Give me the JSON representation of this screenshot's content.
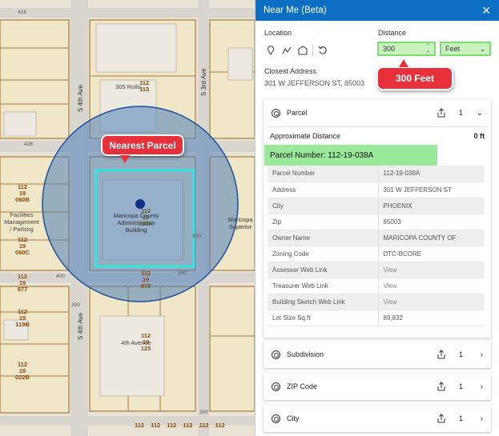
{
  "map": {
    "parcel_numbers": [
      {
        "top": "112",
        "mid": "",
        "bot": "113",
        "name": "305 Rollo"
      },
      {
        "top": "112",
        "mid": "19",
        "bot": "060B",
        "name": "left-upper"
      },
      {
        "top": "112",
        "mid": "19",
        "bot": "060C",
        "name": "left-mid"
      },
      {
        "top": "112",
        "mid": "19",
        "bot": "977",
        "name": "left-977"
      },
      {
        "top": "112",
        "mid": "19",
        "bot": "119B",
        "name": "left-119B"
      },
      {
        "top": "112",
        "mid": "19",
        "bot": "022B",
        "name": "left-022B"
      },
      {
        "top": "112",
        "mid": "19",
        "bot": "978",
        "name": "center-978"
      },
      {
        "top": "112",
        "mid": "19",
        "bot": "125",
        "name": "center-125"
      }
    ],
    "labels": {
      "rollo_bldg": "305 Rollo",
      "facilities_1": "Facilities",
      "facilities_2": "Management",
      "facilities_3": "/ Parking",
      "maricopa_1": "Maricopa County",
      "maricopa_2": "Administration",
      "maricopa_3": "Building",
      "superior_1": "Maricopa",
      "superior_2": "Superior",
      "fourth_ave_bldg": "4th Avenue",
      "center_parcel": "112\n19\n038A"
    },
    "street_labels": {
      "s4th_top": "S 4th Ave",
      "s3rd": "S 3rd Ave",
      "s4th_bottom": "S 4th Ave"
    },
    "address_numbers": {
      "n416": "416",
      "n428": "428",
      "n400": "400",
      "n300a": "300",
      "n300b": "300",
      "n300c": "300",
      "n300d": "300"
    },
    "callouts": {
      "nearest_parcel": "Nearest Parcel",
      "distance_300": "300 Feet"
    },
    "bottom_numbers": [
      "112",
      "112",
      "112",
      "112",
      "112",
      "112"
    ]
  },
  "panel": {
    "title": "Near Me (Beta)",
    "location_label": "Location",
    "distance_label": "Distance",
    "distance_value": "300",
    "unit_value": "Feet",
    "closest_address_label": "Closest Address",
    "closest_address_value": "301 W JEFFERSON ST, 85003",
    "cards": [
      {
        "title": "Parcel",
        "count": "1",
        "expanded": true
      },
      {
        "title": "Subdivision",
        "count": "1",
        "expanded": false
      },
      {
        "title": "ZIP Code",
        "count": "1",
        "expanded": false
      },
      {
        "title": "City",
        "count": "1",
        "expanded": false
      }
    ],
    "approx_distance_label": "Approximate Distance",
    "approx_distance_value": "0 ft",
    "parcel_number_label": "Parcel Number: 112-19-038A",
    "attributes": [
      {
        "k": "Parcel Number",
        "v": "112-19-038A"
      },
      {
        "k": "Address",
        "v": "301 W JEFFERSON ST"
      },
      {
        "k": "City",
        "v": "PHOENIX"
      },
      {
        "k": "Zip",
        "v": "85003"
      },
      {
        "k": "Owner Name",
        "v": "MARICOPA COUNTY OF"
      },
      {
        "k": "Zoning Code",
        "v": "DTC-BCORE"
      },
      {
        "k": "Assessor Web Link",
        "v": "View"
      },
      {
        "k": "Treasurer Web Link",
        "v": "View"
      },
      {
        "k": "Building Sketch Web Link",
        "v": "View"
      },
      {
        "k": "Lot Size Sq.ft",
        "v": "89,832"
      }
    ]
  },
  "colors": {
    "header_blue": "#0d6fc4",
    "callout_red": "#e8303a",
    "buffer_blue": "#5a86b8",
    "highlight_cyan": "#2ee6e6",
    "highlight_green": "#9ae89a"
  }
}
